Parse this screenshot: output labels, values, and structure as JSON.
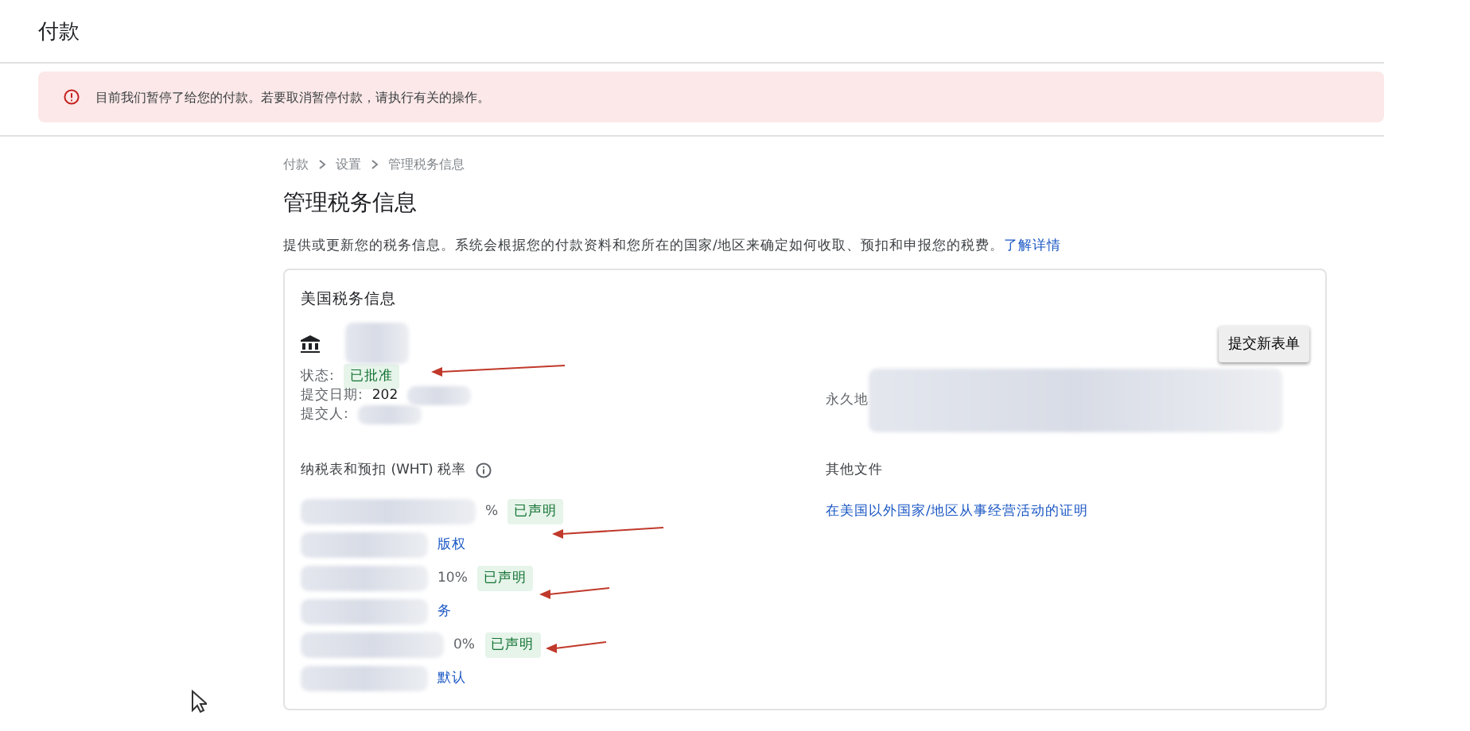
{
  "header": {
    "title": "付款"
  },
  "alert": {
    "text": "目前我们暂停了给您的付款。若要取消暂停付款，请执行有关的操作。"
  },
  "breadcrumb": [
    "付款",
    "设置",
    "管理税务信息"
  ],
  "page": {
    "title": "管理税务信息",
    "description": "提供或更新您的税务信息。系统会根据您的付款资料和您所在的国家/地区来确定如何收取、预扣和申报您的税费。",
    "link": "了解详情"
  },
  "card": {
    "title": "美国税务信息",
    "button": "提交新表单",
    "fields": [
      {
        "label": "状态:",
        "badge": "已批准"
      },
      {
        "label": "提交日期:",
        "value": "202"
      },
      {
        "label": "提交人:"
      }
    ],
    "address_label": "永久地",
    "withholding": {
      "title": "纳税表和预扣 (WHT) 税率",
      "items": [
        {
          "kind": "rate",
          "text": "%",
          "badge": "已声明"
        },
        {
          "kind": "link",
          "text": "版权"
        },
        {
          "kind": "rate",
          "text": "10%",
          "badge": "已声明"
        },
        {
          "kind": "link",
          "text": "务"
        },
        {
          "kind": "rate",
          "text": "0%",
          "badge": "已声明"
        },
        {
          "kind": "link",
          "text": "默认"
        }
      ]
    },
    "other": {
      "title": "其他文件",
      "link": "在美国以外国家/地区从事经营活动的证明"
    }
  }
}
